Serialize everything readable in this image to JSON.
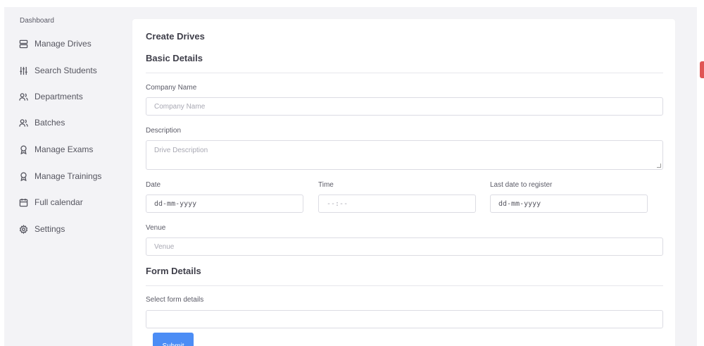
{
  "sidebar": {
    "title": "Dashboard",
    "items": [
      {
        "label": "Manage Drives",
        "icon": "server-icon"
      },
      {
        "label": "Search Students",
        "icon": "sliders-icon"
      },
      {
        "label": "Departments",
        "icon": "users-icon"
      },
      {
        "label": "Batches",
        "icon": "users-icon"
      },
      {
        "label": "Manage Exams",
        "icon": "award-icon"
      },
      {
        "label": "Manage Trainings",
        "icon": "award-icon"
      },
      {
        "label": "Full calendar",
        "icon": "calendar-icon"
      },
      {
        "label": "Settings",
        "icon": "gear-icon"
      }
    ]
  },
  "form": {
    "title": "Create Drives",
    "basic_section": "Basic Details",
    "company_label": "Company Name",
    "company_placeholder": "Company Name",
    "description_label": "Description",
    "description_placeholder": "Drive Description",
    "date_label": "Date",
    "date_value": "dd-mm-yyyy",
    "time_label": "Time",
    "time_value": "--:--",
    "last_date_label": "Last date to register",
    "last_date_value": "dd-mm-yyyy",
    "venue_label": "Venue",
    "venue_placeholder": "Venue",
    "form_section": "Form Details",
    "select_label": "Select form details",
    "select_value": "",
    "submit_label": "Submit"
  },
  "colors": {
    "primary": "#4c8df5",
    "background": "#f3f3f6",
    "card": "#ffffff",
    "accent_tab": "#e05555"
  }
}
